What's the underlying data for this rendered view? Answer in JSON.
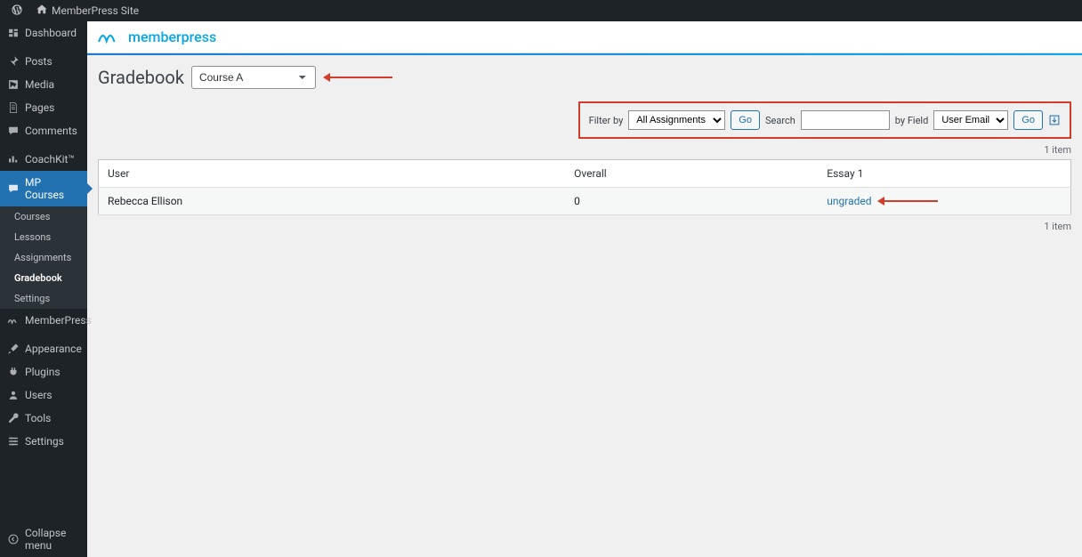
{
  "adminbar": {
    "site_name": "MemberPress Site"
  },
  "brand": {
    "name": "memberpress"
  },
  "sidebar": {
    "dashboard": "Dashboard",
    "posts": "Posts",
    "media": "Media",
    "pages": "Pages",
    "comments": "Comments",
    "coachkit": "CoachKit™",
    "mp_courses": "MP Courses",
    "submenu": {
      "courses": "Courses",
      "lessons": "Lessons",
      "assignments": "Assignments",
      "gradebook": "Gradebook",
      "settings": "Settings"
    },
    "memberpress": "MemberPress",
    "appearance": "Appearance",
    "plugins": "Plugins",
    "users": "Users",
    "tools": "Tools",
    "settings": "Settings",
    "collapse": "Collapse menu"
  },
  "page": {
    "title": "Gradebook",
    "course_selected": "Course A"
  },
  "filters": {
    "filter_by_label": "Filter by",
    "filter_by_value": "All Assignments",
    "go1": "Go",
    "search_label": "Search",
    "search_value": "",
    "by_field_label": "by Field",
    "by_field_value": "User Email",
    "go2": "Go"
  },
  "count": {
    "top": "1 item",
    "bottom": "1 item"
  },
  "table": {
    "headers": {
      "user": "User",
      "overall": "Overall",
      "essay1": "Essay 1"
    },
    "rows": [
      {
        "user": "Rebecca Ellison",
        "overall": "0",
        "essay1": "ungraded"
      }
    ]
  }
}
